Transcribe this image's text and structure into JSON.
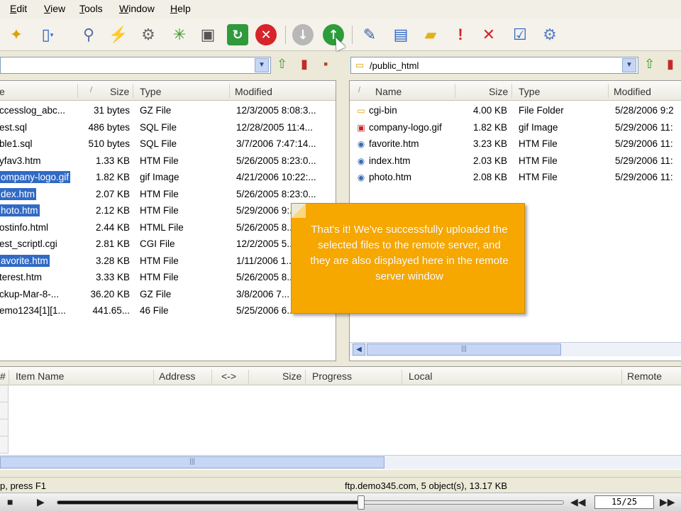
{
  "menu": [
    {
      "label": "Edit"
    },
    {
      "label": "View"
    },
    {
      "label": "Tools"
    },
    {
      "label": "Window"
    },
    {
      "label": "Help"
    }
  ],
  "toolbar_icons": [
    "connect-wand-icon",
    "new-file-icon",
    "disconnect-plug-icon",
    "quick-connect-icon",
    "wizard-icon",
    "sync-icon",
    "archive-icon",
    "refresh-icon",
    "stop-icon",
    "download-icon",
    "upload-icon",
    "edit-icon",
    "view-icon",
    "new-folder-icon",
    "priority-icon",
    "delete-icon",
    "properties-icon",
    "settings-gear-icon"
  ],
  "left_address": {
    "path": ""
  },
  "right_address": {
    "path": "/public_html"
  },
  "left_pane": {
    "columns": {
      "size": "Size",
      "type": "Type",
      "modified": "Modified"
    },
    "rows": [
      {
        "name": "ccesslog_abc...",
        "size": "31 bytes",
        "type": "GZ File",
        "modified": "12/3/2005 8:08:3...",
        "selected": false
      },
      {
        "name": "est.sql",
        "size": "486 bytes",
        "type": "SQL File",
        "modified": "12/28/2005 11:4...",
        "selected": false
      },
      {
        "name": "ble1.sql",
        "size": "510 bytes",
        "type": "SQL File",
        "modified": "3/7/2006 7:47:14...",
        "selected": false
      },
      {
        "name": "yfav3.htm",
        "size": "1.33 KB",
        "type": "HTM File",
        "modified": "5/26/2005 8:23:0...",
        "selected": false
      },
      {
        "name": "ompany-logo.gif",
        "size": "1.82 KB",
        "type": "gif Image",
        "modified": "4/21/2006 10:22:...",
        "selected": true
      },
      {
        "name": "dex.htm",
        "size": "2.07 KB",
        "type": "HTM File",
        "modified": "5/26/2005 8:23:0...",
        "selected": true
      },
      {
        "name": "hoto.htm",
        "size": "2.12 KB",
        "type": "HTM File",
        "modified": "5/29/2006 9:...",
        "selected": true
      },
      {
        "name": "ostinfo.html",
        "size": "2.44 KB",
        "type": "HTML File",
        "modified": "5/26/2005 8...",
        "selected": false
      },
      {
        "name": "est_scriptl.cgi",
        "size": "2.81 KB",
        "type": "CGI File",
        "modified": "12/2/2005 5...",
        "selected": false
      },
      {
        "name": "avorite.htm",
        "size": "3.28 KB",
        "type": "HTM File",
        "modified": "1/11/2006 1...",
        "selected": true
      },
      {
        "name": "terest.htm",
        "size": "3.33 KB",
        "type": "HTM File",
        "modified": "5/26/2005 8...",
        "selected": false
      },
      {
        "name": "ckup-Mar-8-...",
        "size": "36.20 KB",
        "type": "GZ File",
        "modified": "3/8/2006 7...",
        "selected": false
      },
      {
        "name": "emo1234[1][1...",
        "size": "441.65...",
        "type": "46 File",
        "modified": "5/25/2006 6...",
        "selected": false
      }
    ]
  },
  "right_pane": {
    "columns": {
      "name": "Name",
      "size": "Size",
      "type": "Type",
      "modified": "Modified"
    },
    "rows": [
      {
        "name": "cgi-bin",
        "icon": "folder-icon",
        "size": "4.00 KB",
        "type": "File Folder",
        "modified": "5/28/2006 9:2"
      },
      {
        "name": "company-logo.gif",
        "icon": "gif-file-icon",
        "size": "1.82 KB",
        "type": "gif Image",
        "modified": "5/29/2006 11:"
      },
      {
        "name": "favorite.htm",
        "icon": "htm-file-icon",
        "size": "3.23 KB",
        "type": "HTM File",
        "modified": "5/29/2006 11:"
      },
      {
        "name": "index.htm",
        "icon": "htm-file-icon",
        "size": "2.03 KB",
        "type": "HTM File",
        "modified": "5/29/2006 11:"
      },
      {
        "name": "photo.htm",
        "icon": "htm-file-icon",
        "size": "2.08 KB",
        "type": "HTM File",
        "modified": "5/29/2006 11:"
      }
    ]
  },
  "queue": {
    "columns": {
      "num": "#",
      "item": "Item Name",
      "address": "Address",
      "direction": "<->",
      "size": "Size",
      "progress": "Progress",
      "local": "Local",
      "remote": "Remote"
    }
  },
  "callout": {
    "text": "That's it! We've successfully uploaded the selected files to the remote server, and they are also displayed here in the remote server window"
  },
  "status": {
    "left": "p, press F1",
    "right": "ftp.demo345.com, 5 object(s), 13.17 KB"
  },
  "player": {
    "counter": "15/25",
    "progress": 0.6
  },
  "colors": {
    "selection": "#316ac5",
    "callout": "#f7a800"
  }
}
